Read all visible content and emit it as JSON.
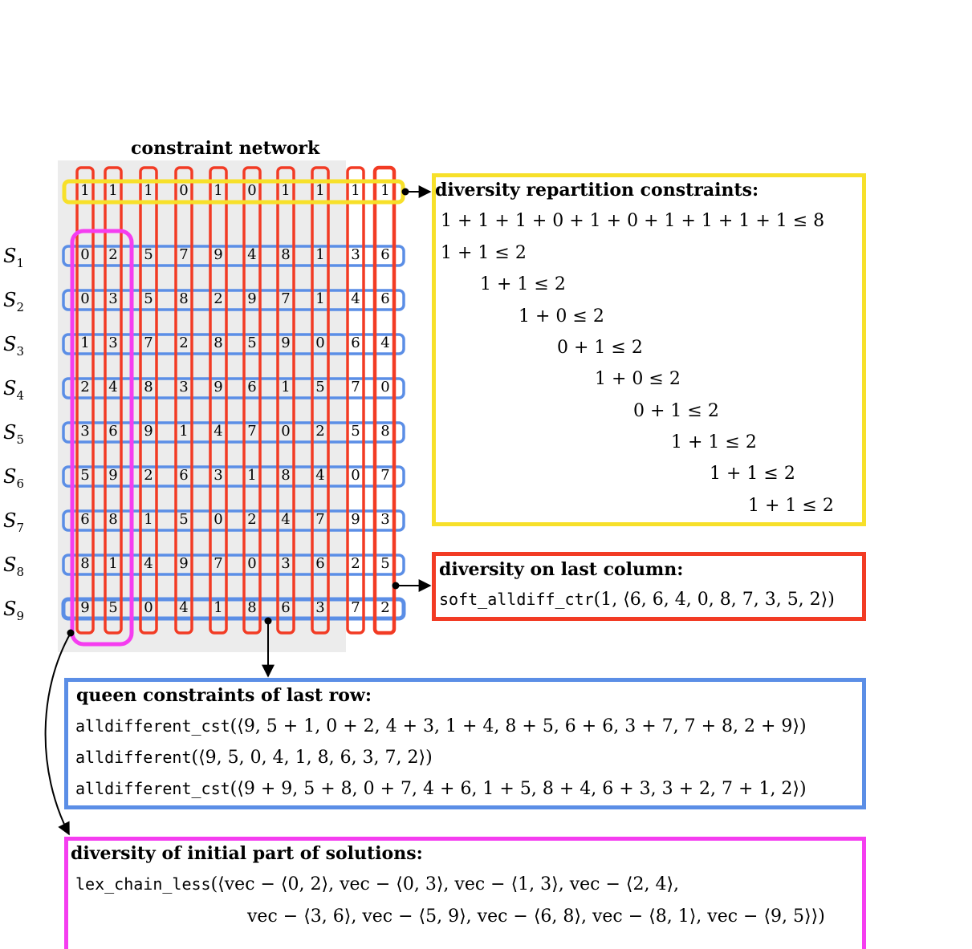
{
  "network_title": "constraint network",
  "header_row": [
    "1",
    "1",
    "1",
    "0",
    "1",
    "0",
    "1",
    "1",
    "1",
    "1"
  ],
  "solutions": [
    {
      "label": "S",
      "sub": "1",
      "values": [
        "0",
        "2",
        "5",
        "7",
        "9",
        "4",
        "8",
        "1",
        "3",
        "6"
      ]
    },
    {
      "label": "S",
      "sub": "2",
      "values": [
        "0",
        "3",
        "5",
        "8",
        "2",
        "9",
        "7",
        "1",
        "4",
        "6"
      ]
    },
    {
      "label": "S",
      "sub": "3",
      "values": [
        "1",
        "3",
        "7",
        "2",
        "8",
        "5",
        "9",
        "0",
        "6",
        "4"
      ]
    },
    {
      "label": "S",
      "sub": "4",
      "values": [
        "2",
        "4",
        "8",
        "3",
        "9",
        "6",
        "1",
        "5",
        "7",
        "0"
      ]
    },
    {
      "label": "S",
      "sub": "5",
      "values": [
        "3",
        "6",
        "9",
        "1",
        "4",
        "7",
        "0",
        "2",
        "5",
        "8"
      ]
    },
    {
      "label": "S",
      "sub": "6",
      "values": [
        "5",
        "9",
        "2",
        "6",
        "3",
        "1",
        "8",
        "4",
        "0",
        "7"
      ]
    },
    {
      "label": "S",
      "sub": "7",
      "values": [
        "6",
        "8",
        "1",
        "5",
        "0",
        "2",
        "4",
        "7",
        "9",
        "3"
      ]
    },
    {
      "label": "S",
      "sub": "8",
      "values": [
        "8",
        "1",
        "4",
        "9",
        "7",
        "0",
        "3",
        "6",
        "2",
        "5"
      ]
    },
    {
      "label": "S",
      "sub": "9",
      "values": [
        "9",
        "5",
        "0",
        "4",
        "1",
        "8",
        "6",
        "3",
        "7",
        "2"
      ]
    }
  ],
  "repartition": {
    "title": "diversity repartition constraints:",
    "lines": [
      "1 + 1 + 1 + 0 + 1 + 0 + 1 + 1 + 1 + 1 ≤ 8",
      "1 + 1 ≤ 2",
      "1 + 1 ≤ 2",
      "1 + 0 ≤ 2",
      "0 + 1 ≤ 2",
      "1 + 0 ≤ 2",
      "0 + 1 ≤ 2",
      "1 + 1 ≤ 2",
      "1 + 1 ≤ 2",
      "1 + 1 ≤ 2"
    ]
  },
  "last_column": {
    "title": "diversity on last column:",
    "fn": "soft_alldiff_ctr",
    "args": "(1, ⟨6, 6, 4, 0, 8, 7, 3, 5, 2⟩)"
  },
  "queen": {
    "title": "queen constraints of last row:",
    "lines": [
      {
        "fn": "alldifferent_cst",
        "args": "(⟨9, 5 + 1, 0 + 2, 4 + 3, 1 + 4, 8 + 5, 6 + 6, 3 + 7, 7 + 8, 2 + 9⟩)"
      },
      {
        "fn": "alldifferent",
        "args": "(⟨9, 5, 0, 4, 1, 8, 6, 3, 7, 2⟩)"
      },
      {
        "fn": "alldifferent_cst",
        "args": "(⟨9 + 9, 5 + 8, 0 + 7, 4 + 6, 1 + 5, 8 + 4, 6 + 3, 3 + 2, 7 + 1, 2⟩)"
      }
    ]
  },
  "initial": {
    "title": "diversity of initial part of solutions:",
    "line1_fn": "lex_chain_less",
    "line1_rest": "(⟨vec − ⟨0, 2⟩, vec − ⟨0, 3⟩, vec − ⟨1, 3⟩, vec − ⟨2, 4⟩,",
    "line2": "vec − ⟨3, 6⟩, vec − ⟨5, 9⟩, vec − ⟨6, 8⟩, vec − ⟨8, 1⟩, vec − ⟨9, 5⟩⟩)"
  },
  "colors": {
    "yellow": "#f7e02a",
    "red": "#f23b24",
    "blue": "#5b8ee6",
    "magenta": "#f53df0",
    "gray": "#ececec"
  }
}
